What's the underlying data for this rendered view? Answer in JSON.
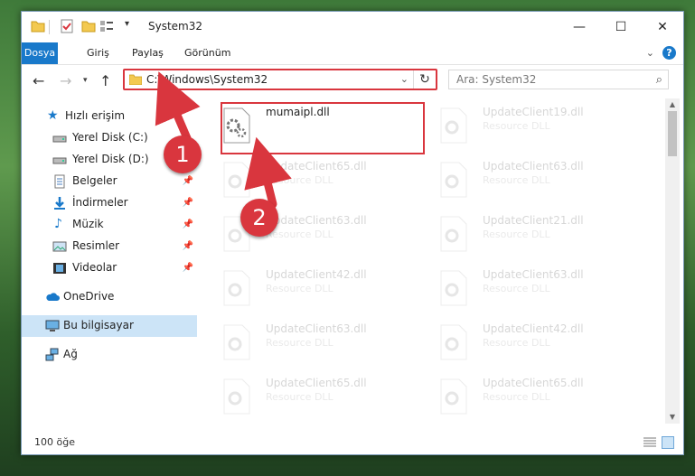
{
  "window": {
    "title": "System32"
  },
  "ribbon": {
    "tabs": [
      "Dosya",
      "Giriş",
      "Paylaş",
      "Görünüm"
    ],
    "help_label": "?"
  },
  "address": {
    "path": "C:\\Windows\\System32",
    "search_placeholder": "Ara: System32"
  },
  "sidebar": {
    "items": [
      {
        "label": "Hızlı erişim",
        "icon": "star-icon"
      },
      {
        "label": "Yerel Disk (C:)",
        "icon": "drive-icon"
      },
      {
        "label": "Yerel Disk (D:)",
        "icon": "drive-icon"
      },
      {
        "label": "Belgeler",
        "icon": "document-icon"
      },
      {
        "label": "İndirmeler",
        "icon": "download-icon"
      },
      {
        "label": "Müzik",
        "icon": "music-icon"
      },
      {
        "label": "Resimler",
        "icon": "picture-icon"
      },
      {
        "label": "Videolar",
        "icon": "video-icon"
      },
      {
        "label": "OneDrive",
        "icon": "cloud-icon"
      },
      {
        "label": "Bu bilgisayar",
        "icon": "computer-icon"
      },
      {
        "label": "Ağ",
        "icon": "network-icon"
      }
    ]
  },
  "files": {
    "highlighted": {
      "name": "mumaipl.dll"
    },
    "ghost": [
      {
        "name": "UpdateClient19.dll",
        "type": "Resource DLL"
      },
      {
        "name": "UpdateClient65.dll",
        "type": "Resource DLL"
      },
      {
        "name": "UpdateClient63.dll",
        "type": "Resource DLL"
      },
      {
        "name": "UpdateClient63.dll",
        "type": "Resource DLL"
      },
      {
        "name": "UpdateClient21.dll",
        "type": "Resource DLL"
      },
      {
        "name": "UpdateClient42.dll",
        "type": "Resource DLL"
      },
      {
        "name": "UpdateClient63.dll",
        "type": "Resource DLL"
      },
      {
        "name": "UpdateClient63.dll",
        "type": "Resource DLL"
      },
      {
        "name": "UpdateClient42.dll",
        "type": "Resource DLL"
      },
      {
        "name": "UpdateClient65.dll",
        "type": "Resource DLL"
      },
      {
        "name": "UpdateClient65.dll",
        "type": "Resource DLL"
      }
    ]
  },
  "status": {
    "item_count": "100 öğe"
  },
  "annotations": {
    "step1": "1",
    "step2": "2",
    "color": "#d9363e"
  }
}
